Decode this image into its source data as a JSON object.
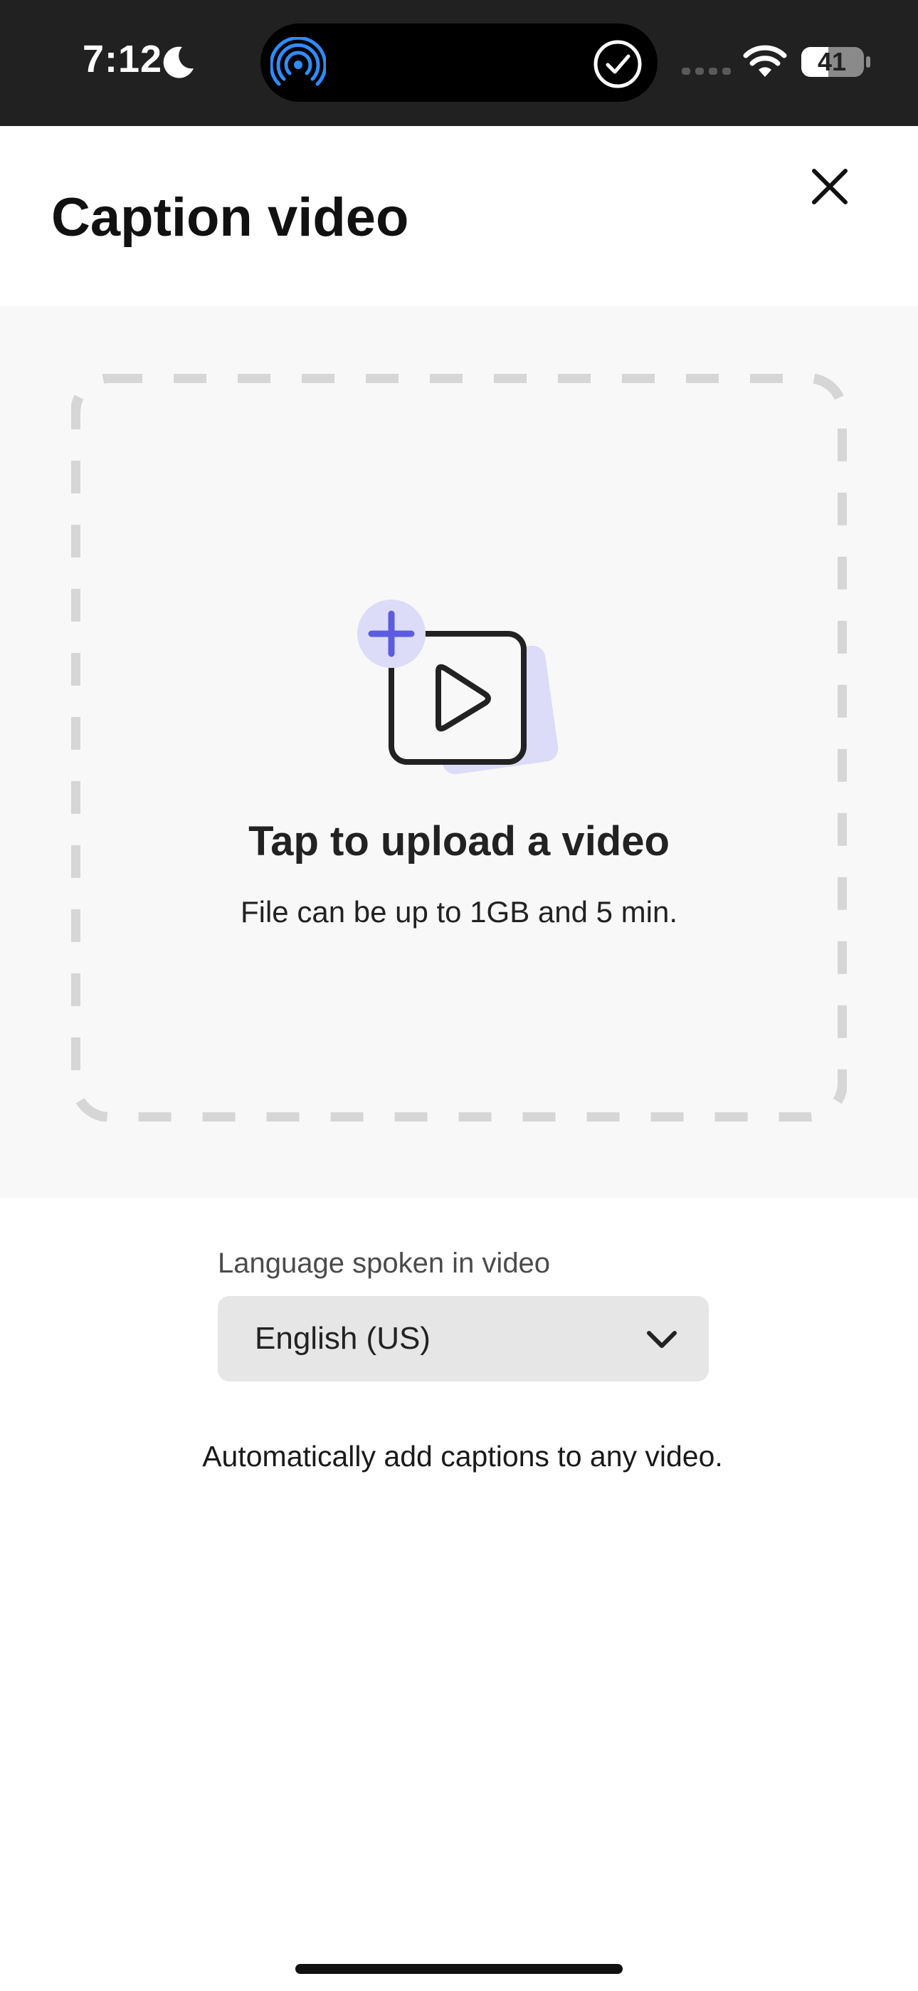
{
  "status_bar": {
    "time": "7:12",
    "battery": "41",
    "icons": [
      "moon-icon",
      "airdrop-icon",
      "check-circle-icon",
      "signal-icon",
      "wifi-icon",
      "battery-icon"
    ]
  },
  "header": {
    "title": "Caption video",
    "close_icon": "close-icon"
  },
  "upload": {
    "title": "Tap to upload a video",
    "subtitle": "File can be up to 1GB and 5 min.",
    "illustration_icon": "video-add-icon"
  },
  "language": {
    "label": "Language spoken in video",
    "selected": "English (US)",
    "icon": "chevron-down-icon"
  },
  "description": "Automatically add captions to any video.",
  "colors": {
    "status_bar_bg": "#212121",
    "upload_bg": "#f8f8f8",
    "dropzone_border": "#d6d6d6",
    "accent_purple": "#5c5ce0",
    "accent_purple_light": "#dcdcf8",
    "airdrop_blue": "#2f8cff",
    "select_bg": "#e6e6e6"
  }
}
